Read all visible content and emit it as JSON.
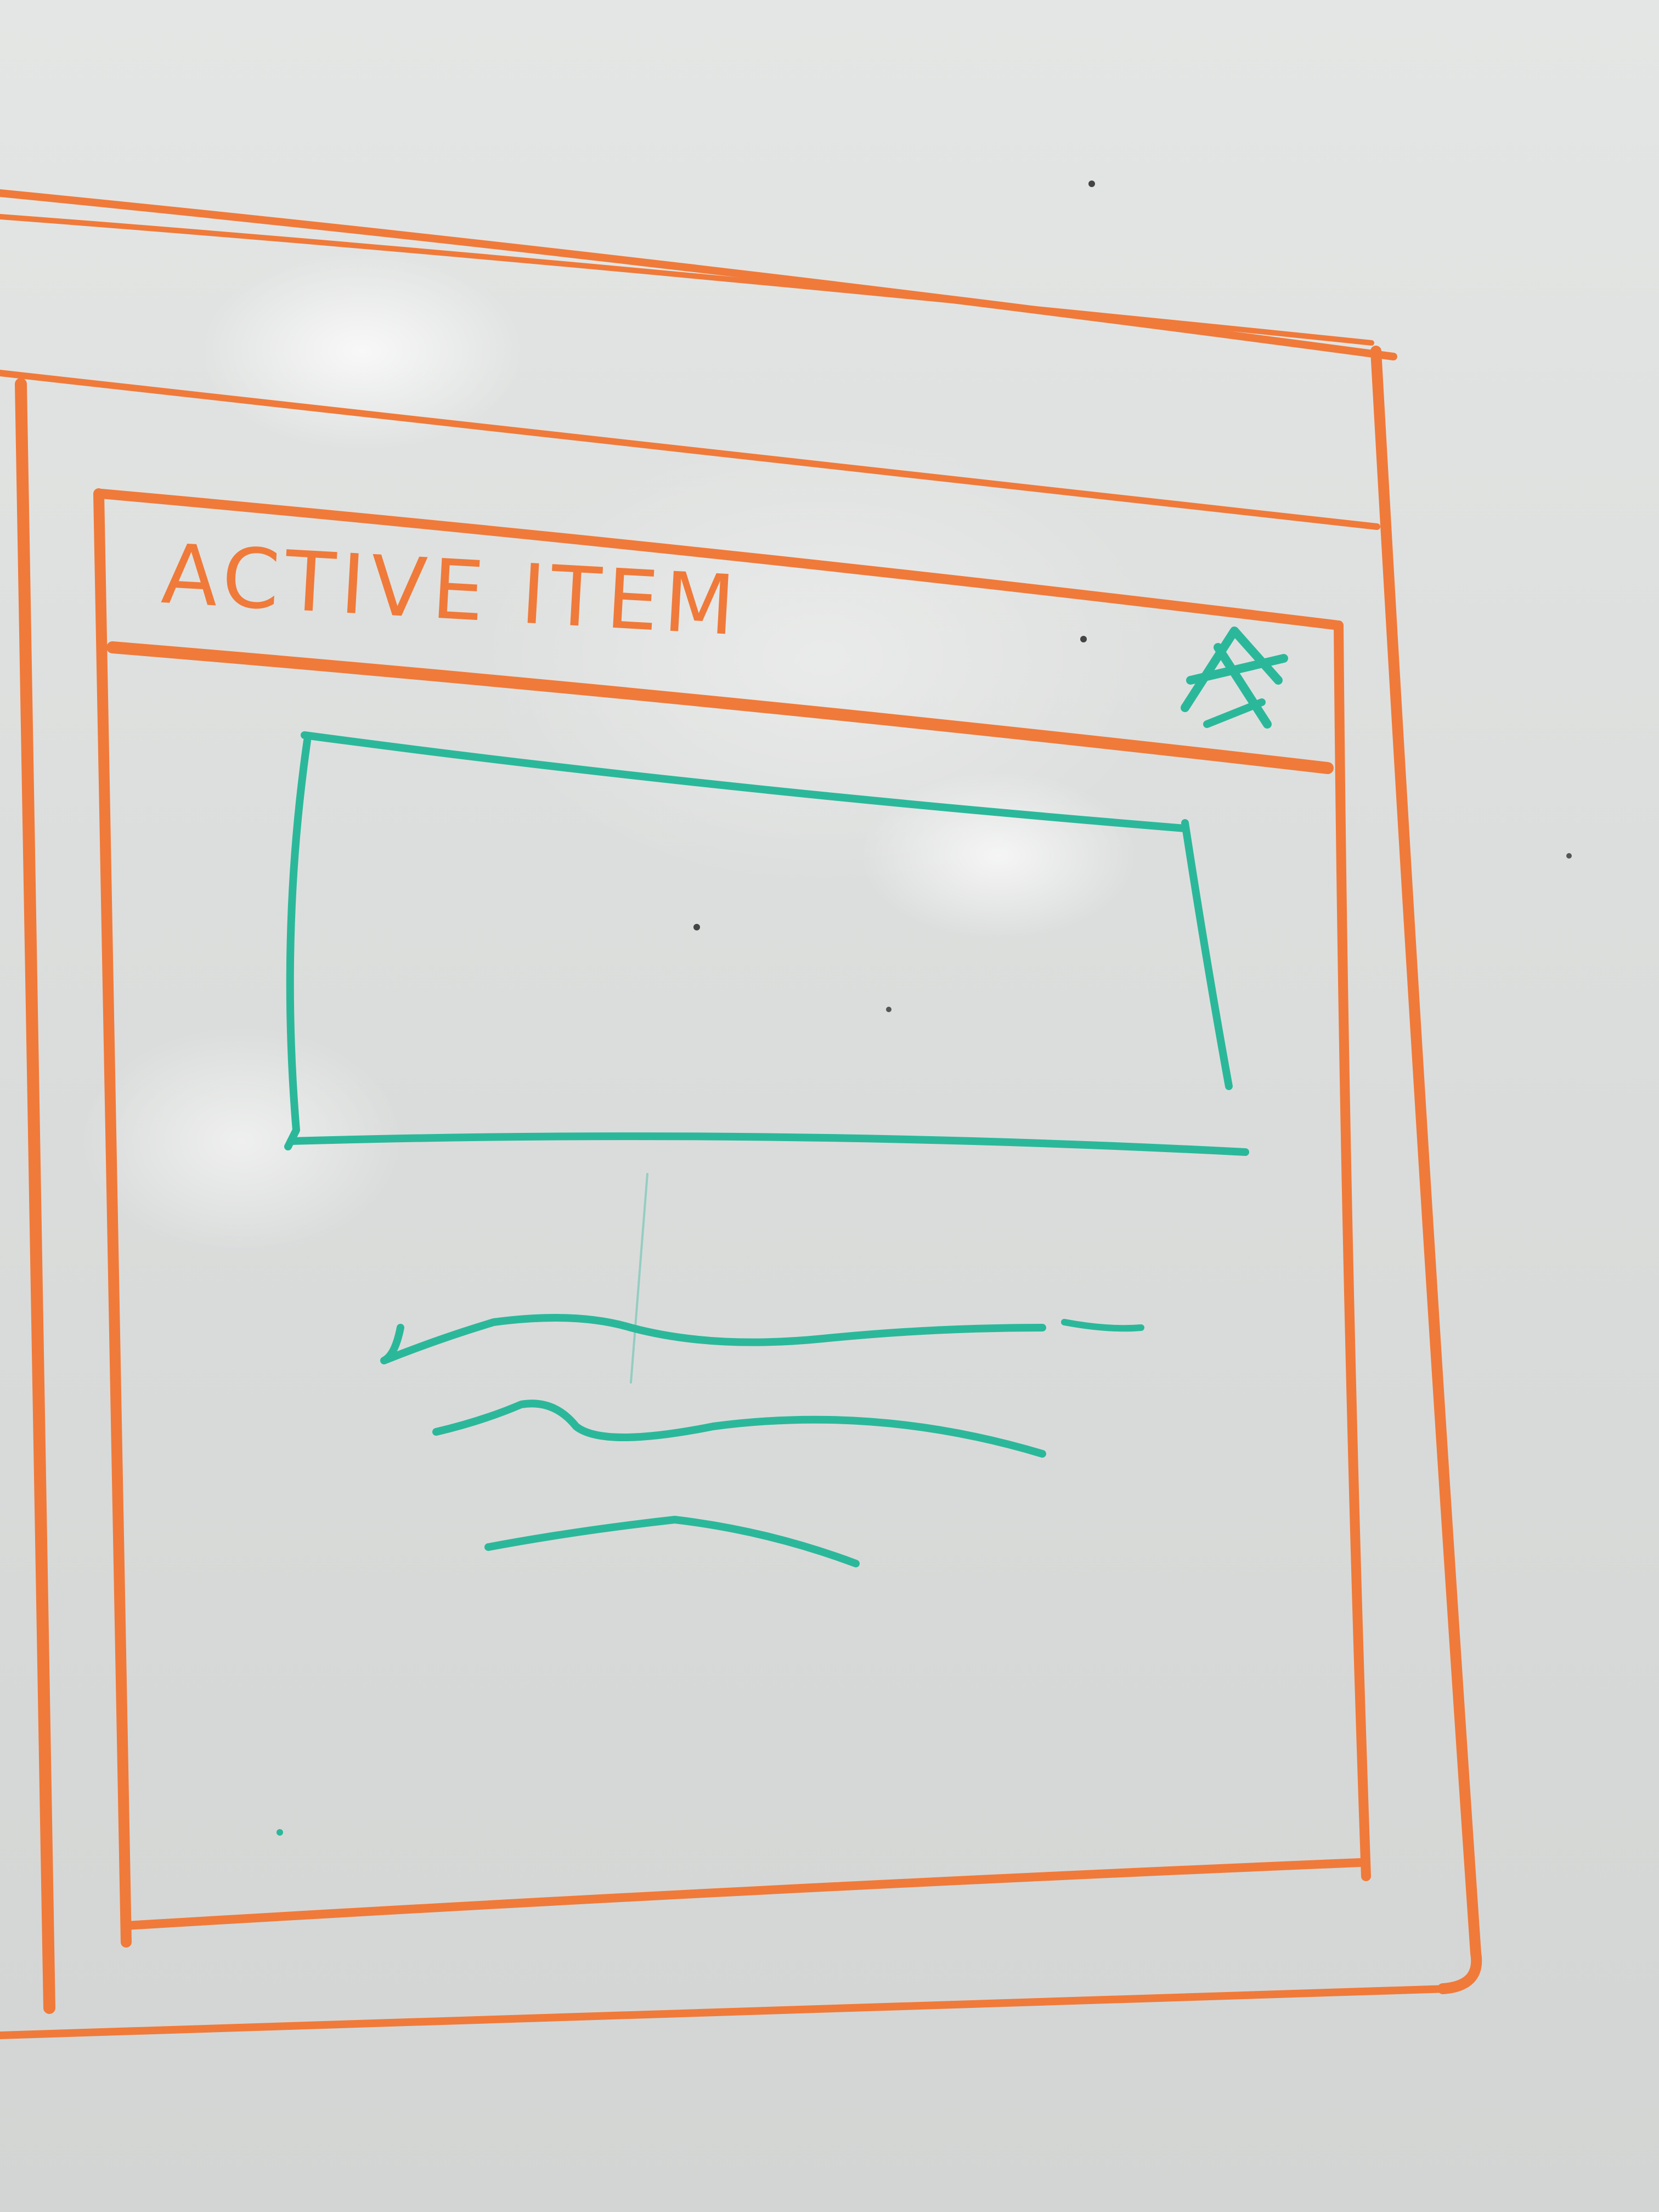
{
  "window": {
    "title": "ACTIVE ITEM",
    "close_icon": "close-icon"
  },
  "content": {
    "image_placeholder": "image-placeholder",
    "text_lines": 3
  },
  "colors": {
    "frame": "#f07a3a",
    "content": "#2bb89a",
    "board": "#dcdedd"
  }
}
